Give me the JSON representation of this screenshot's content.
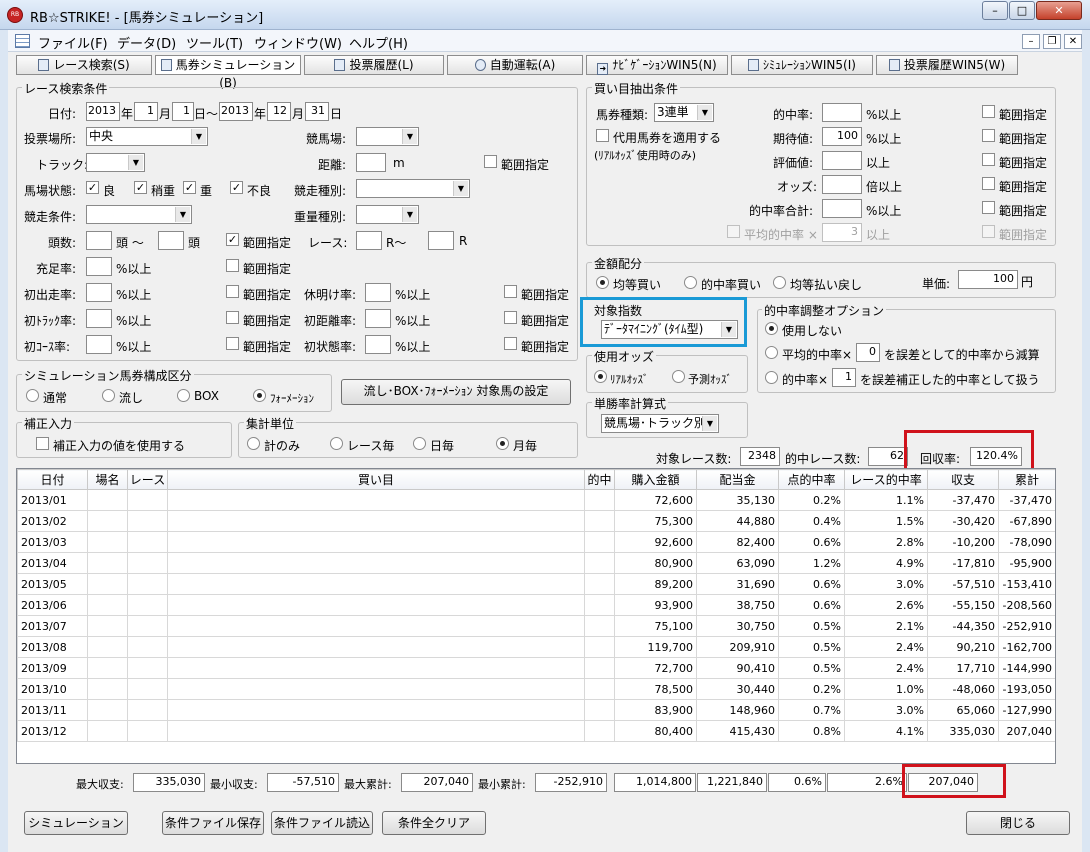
{
  "window": {
    "title": "RB☆STRIKE! - [馬券シミュレーション]",
    "icon": "RB"
  },
  "menu": [
    "ファイル(F)",
    "データ(D)",
    "ツール(T)",
    "ウィンドウ(W)",
    "ヘルプ(H)"
  ],
  "tabs": [
    {
      "label": "レース検索(S)",
      "icon": "search-icon"
    },
    {
      "label": "馬券シミュレーション(B)",
      "icon": "table-icon"
    },
    {
      "label": "投票履歴(L)",
      "icon": "document-icon"
    },
    {
      "label": "自動運転(A)",
      "icon": "clock-icon"
    },
    {
      "label": "ﾅﾋﾞｹﾞｰｼｮﾝWIN5(N)",
      "icon": "arrow-icon"
    },
    {
      "label": "ｼﾐｭﾚｰｼｮﾝWIN5(I)",
      "icon": "table-icon"
    },
    {
      "label": "投票履歴WIN5(W)",
      "icon": "document-icon"
    }
  ],
  "race_search": {
    "title": "レース検索条件",
    "date": {
      "label": "日付:",
      "from_year": "2013",
      "from_month": "1",
      "from_day": "1",
      "to_year": "2013",
      "to_month": "12",
      "to_day": "31",
      "u_year": "年",
      "u_month": "月",
      "u_day_from": "日〜",
      "u_day": "日"
    },
    "venue": {
      "label": "投票場所:",
      "value": "中央"
    },
    "course": {
      "label": "競馬場:",
      "value": ""
    },
    "track": {
      "label": "トラック:",
      "value": ""
    },
    "distance": {
      "label": "距離:",
      "value": "",
      "unit": "m",
      "range": "範囲指定"
    },
    "condition": {
      "label": "馬場状態:",
      "options": [
        {
          "label": "良",
          "checked": true
        },
        {
          "label": "稍重",
          "checked": true
        },
        {
          "label": "重",
          "checked": true
        },
        {
          "label": "不良",
          "checked": true
        }
      ]
    },
    "race_type": {
      "label": "競走種別:",
      "value": ""
    },
    "race_cond": {
      "label": "競走条件:",
      "value": ""
    },
    "weight_type": {
      "label": "重量種別:",
      "value": ""
    },
    "heads": {
      "label": "頭数:",
      "from": "",
      "mid": "頭 〜",
      "to": "",
      "unit": "頭",
      "range": "範囲指定",
      "range_checked": true
    },
    "race_no": {
      "label": "レース:",
      "from": "",
      "mid": "R〜",
      "to": "",
      "unit": "R"
    },
    "fill_rate": {
      "label": "充足率:",
      "value": "",
      "unit": "%以上",
      "range": "範囲指定"
    },
    "rows": [
      {
        "label": "初出走率:",
        "unit": "%以上",
        "range": "範囲指定",
        "label2": "休明け率:",
        "unit2": "%以上",
        "range2": "範囲指定"
      },
      {
        "label": "初ﾄﾗｯｸ率:",
        "unit": "%以上",
        "range": "範囲指定",
        "label2": "初距離率:",
        "unit2": "%以上",
        "range2": "範囲指定"
      },
      {
        "label": "初ｺｰｽ率:",
        "unit": "%以上",
        "range": "範囲指定",
        "label2": "初状態率:",
        "unit2": "%以上",
        "range2": "範囲指定"
      }
    ]
  },
  "composition": {
    "title": "シミュレーション馬券構成区分",
    "options": [
      "通常",
      "流し",
      "BOX",
      "ﾌｫｰﾒｰｼｮﾝ"
    ],
    "selected": 3,
    "button": "流し･BOX･ﾌｫｰﾒｰｼｮﾝ 対象馬の設定"
  },
  "correction": {
    "title": "補正入力",
    "checkbox": "補正入力の値を使用する"
  },
  "agg_unit": {
    "title": "集計単位",
    "options": [
      "計のみ",
      "レース毎",
      "日毎",
      "月毎"
    ],
    "selected": 3
  },
  "extract": {
    "title": "買い目抽出条件",
    "ticket_type": {
      "label": "馬券種類:",
      "value": "3連単"
    },
    "proxy": {
      "label": "代用馬券を適用する",
      "note": "(ﾘｱﾙｵｯｽﾞ使用時のみ)"
    },
    "criteria": [
      {
        "label": "的中率:",
        "value": "",
        "unit": "%以上",
        "range": "範囲指定"
      },
      {
        "label": "期待値:",
        "value": "100",
        "unit": "%以上",
        "range": "範囲指定"
      },
      {
        "label": "評価値:",
        "value": "",
        "unit": "以上",
        "range": "範囲指定"
      },
      {
        "label": "オッズ:",
        "value": "",
        "unit": "倍以上",
        "range": "範囲指定"
      },
      {
        "label": "的中率合計:",
        "value": "",
        "unit": "%以上",
        "range": "範囲指定"
      }
    ],
    "avg": {
      "label": "平均的中率 ×",
      "value": "3",
      "unit": "以上",
      "range": "範囲指定"
    }
  },
  "allocation": {
    "title": "金額配分",
    "options": [
      "均等買い",
      "的中率買い",
      "均等払い戻し"
    ],
    "selected": 0,
    "unit_label": "単価:",
    "unit_value": "100",
    "unit_suffix": "円"
  },
  "index": {
    "title": "対象指数",
    "value": "ﾃﾞｰﾀﾏｲﾆﾝｸﾞ(ﾀｲﾑ型)"
  },
  "odds": {
    "title": "使用オッズ",
    "options": [
      "ﾘｱﾙｵｯｽﾞ",
      "予測ｵｯｽﾞ"
    ],
    "selected": 0
  },
  "win_calc": {
    "title": "単勝率計算式",
    "value": "競馬場･トラック別"
  },
  "hit_adjust": {
    "title": "的中率調整オプション",
    "opt1": "使用しない",
    "opt2_pre": "平均的中率×",
    "opt2_val": "0",
    "opt2_post": "を誤差として的中率から減算",
    "opt3_pre": "的中率×",
    "opt3_val": "1",
    "opt3_post": "を誤差補正した的中率として扱う",
    "selected": 0
  },
  "summary": {
    "races_label": "対象レース数:",
    "races": "2348",
    "hits_label": "的中レース数:",
    "hits": "62",
    "return_label": "回収率:",
    "return_rate": "120.4%"
  },
  "table": {
    "headers": [
      "日付",
      "場名",
      "レース",
      "買い目",
      "的中",
      "購入金額",
      "配当金",
      "点的中率",
      "レース的中率",
      "収支",
      "累計"
    ],
    "rows": [
      [
        "2013/01",
        "",
        "",
        "",
        "",
        "72,600",
        "35,130",
        "0.2%",
        "1.1%",
        "-37,470",
        "-37,470"
      ],
      [
        "2013/02",
        "",
        "",
        "",
        "",
        "75,300",
        "44,880",
        "0.4%",
        "1.5%",
        "-30,420",
        "-67,890"
      ],
      [
        "2013/03",
        "",
        "",
        "",
        "",
        "92,600",
        "82,400",
        "0.6%",
        "2.8%",
        "-10,200",
        "-78,090"
      ],
      [
        "2013/04",
        "",
        "",
        "",
        "",
        "80,900",
        "63,090",
        "1.2%",
        "4.9%",
        "-17,810",
        "-95,900"
      ],
      [
        "2013/05",
        "",
        "",
        "",
        "",
        "89,200",
        "31,690",
        "0.6%",
        "3.0%",
        "-57,510",
        "-153,410"
      ],
      [
        "2013/06",
        "",
        "",
        "",
        "",
        "93,900",
        "38,750",
        "0.6%",
        "2.6%",
        "-55,150",
        "-208,560"
      ],
      [
        "2013/07",
        "",
        "",
        "",
        "",
        "75,100",
        "30,750",
        "0.5%",
        "2.1%",
        "-44,350",
        "-252,910"
      ],
      [
        "2013/08",
        "",
        "",
        "",
        "",
        "119,700",
        "209,910",
        "0.5%",
        "2.4%",
        "90,210",
        "-162,700"
      ],
      [
        "2013/09",
        "",
        "",
        "",
        "",
        "72,700",
        "90,410",
        "0.5%",
        "2.4%",
        "17,710",
        "-144,990"
      ],
      [
        "2013/10",
        "",
        "",
        "",
        "",
        "78,500",
        "30,440",
        "0.2%",
        "1.0%",
        "-48,060",
        "-193,050"
      ],
      [
        "2013/11",
        "",
        "",
        "",
        "",
        "83,900",
        "148,960",
        "0.7%",
        "3.0%",
        "65,060",
        "-127,990"
      ],
      [
        "2013/12",
        "",
        "",
        "",
        "",
        "80,400",
        "415,430",
        "0.8%",
        "4.1%",
        "335,030",
        "207,040"
      ]
    ]
  },
  "footer": {
    "max_pl_label": "最大収支:",
    "max_pl": "335,030",
    "min_pl_label": "最小収支:",
    "min_pl": "-57,510",
    "max_cum_label": "最大累計:",
    "max_cum": "207,040",
    "min_cum_label": "最小累計:",
    "min_cum": "-252,910",
    "total_buy": "1,014,800",
    "total_pay": "1,221,840",
    "pt_hit": "0.6%",
    "race_hit": "2.6%",
    "total_pl": "207,040"
  },
  "buttons": {
    "simulate": "シミュレーション",
    "save": "条件ファイル保存",
    "load": "条件ファイル読込",
    "clear": "条件全クリア",
    "close": "閉じる"
  },
  "colors": {
    "highlight_red": "#d0121b",
    "highlight_blue": "#1a9ad6"
  }
}
